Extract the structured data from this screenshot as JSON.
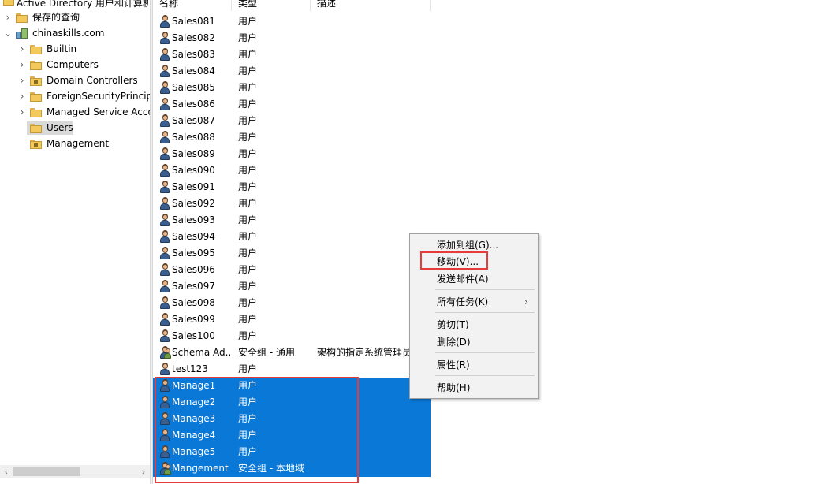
{
  "tree": {
    "root_label": "Active Directory 用户和计算机",
    "items": [
      {
        "label": "保存的查询",
        "indent": 0,
        "chevron": "›"
      },
      {
        "label": "chinaskills.com",
        "indent": 0,
        "chevron": "⌄"
      },
      {
        "label": "Builtin",
        "indent": 1,
        "chevron": "›"
      },
      {
        "label": "Computers",
        "indent": 1,
        "chevron": "›"
      },
      {
        "label": "Domain Controllers",
        "indent": 1,
        "chevron": "›"
      },
      {
        "label": "ForeignSecurityPrincipals",
        "indent": 1,
        "chevron": "›"
      },
      {
        "label": "Managed Service Accounts",
        "indent": 1,
        "chevron": "›"
      },
      {
        "label": "Users",
        "indent": 1,
        "chevron": ""
      },
      {
        "label": "Management",
        "indent": 1,
        "chevron": ""
      }
    ],
    "selected": "Users"
  },
  "list": {
    "columns": {
      "name": "名称",
      "type": "类型",
      "desc": "描述"
    },
    "rows": [
      {
        "name": "Sales081",
        "type": "用户",
        "desc": "",
        "icon": "user"
      },
      {
        "name": "Sales082",
        "type": "用户",
        "desc": "",
        "icon": "user"
      },
      {
        "name": "Sales083",
        "type": "用户",
        "desc": "",
        "icon": "user"
      },
      {
        "name": "Sales084",
        "type": "用户",
        "desc": "",
        "icon": "user"
      },
      {
        "name": "Sales085",
        "type": "用户",
        "desc": "",
        "icon": "user"
      },
      {
        "name": "Sales086",
        "type": "用户",
        "desc": "",
        "icon": "user"
      },
      {
        "name": "Sales087",
        "type": "用户",
        "desc": "",
        "icon": "user"
      },
      {
        "name": "Sales088",
        "type": "用户",
        "desc": "",
        "icon": "user"
      },
      {
        "name": "Sales089",
        "type": "用户",
        "desc": "",
        "icon": "user"
      },
      {
        "name": "Sales090",
        "type": "用户",
        "desc": "",
        "icon": "user"
      },
      {
        "name": "Sales091",
        "type": "用户",
        "desc": "",
        "icon": "user"
      },
      {
        "name": "Sales092",
        "type": "用户",
        "desc": "",
        "icon": "user"
      },
      {
        "name": "Sales093",
        "type": "用户",
        "desc": "",
        "icon": "user"
      },
      {
        "name": "Sales094",
        "type": "用户",
        "desc": "",
        "icon": "user"
      },
      {
        "name": "Sales095",
        "type": "用户",
        "desc": "",
        "icon": "user"
      },
      {
        "name": "Sales096",
        "type": "用户",
        "desc": "",
        "icon": "user"
      },
      {
        "name": "Sales097",
        "type": "用户",
        "desc": "",
        "icon": "user"
      },
      {
        "name": "Sales098",
        "type": "用户",
        "desc": "",
        "icon": "user"
      },
      {
        "name": "Sales099",
        "type": "用户",
        "desc": "",
        "icon": "user"
      },
      {
        "name": "Sales100",
        "type": "用户",
        "desc": "",
        "icon": "user"
      },
      {
        "name": "Schema Ad...",
        "type": "安全组 - 通用",
        "desc": "架构的指定系统管理员",
        "icon": "group"
      },
      {
        "name": "test123",
        "type": "用户",
        "desc": "",
        "icon": "user"
      },
      {
        "name": "Manage1",
        "type": "用户",
        "desc": "",
        "icon": "user",
        "selected": true
      },
      {
        "name": "Manage2",
        "type": "用户",
        "desc": "",
        "icon": "user",
        "selected": true
      },
      {
        "name": "Manage3",
        "type": "用户",
        "desc": "",
        "icon": "user",
        "selected": true
      },
      {
        "name": "Manage4",
        "type": "用户",
        "desc": "",
        "icon": "user",
        "selected": true
      },
      {
        "name": "Manage5",
        "type": "用户",
        "desc": "",
        "icon": "user",
        "selected": true
      },
      {
        "name": "Mangement",
        "type": "安全组 - 本地域",
        "desc": "",
        "icon": "group",
        "selected": true
      }
    ]
  },
  "context_menu": {
    "items": [
      {
        "label": "添加到组(G)...",
        "group": 0
      },
      {
        "label": "移动(V)...",
        "group": 0,
        "highlighted": true
      },
      {
        "label": "发送邮件(A)",
        "group": 0
      },
      {
        "label": "所有任务(K)",
        "group": 1,
        "submenu": "›"
      },
      {
        "label": "剪切(T)",
        "group": 2
      },
      {
        "label": "删除(D)",
        "group": 2
      },
      {
        "label": "属性(R)",
        "group": 3
      },
      {
        "label": "帮助(H)",
        "group": 4
      }
    ]
  },
  "colors": {
    "selection": "#0a78d7",
    "annotation": "#e63b3b",
    "menu_bg": "#f2f2f2"
  },
  "scrollbar": {
    "left_arrow": "‹",
    "right_arrow": "›"
  }
}
